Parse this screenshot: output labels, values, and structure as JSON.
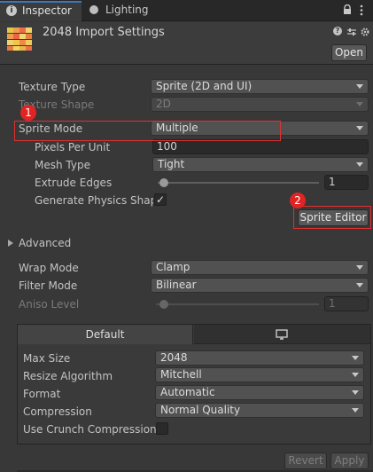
{
  "tabs": [
    {
      "label": "Inspector",
      "icon": "info-icon"
    },
    {
      "label": "Lighting",
      "icon": "lightbulb-icon"
    }
  ],
  "header": {
    "title": "2048 Import Settings",
    "open_label": "Open"
  },
  "texture_type": {
    "label": "Texture Type",
    "value": "Sprite (2D and UI)"
  },
  "texture_shape": {
    "label": "Texture Shape",
    "value": "2D"
  },
  "sprite_mode": {
    "label": "Sprite Mode",
    "value": "Multiple"
  },
  "pixels_per_unit": {
    "label": "Pixels Per Unit",
    "value": "100"
  },
  "mesh_type": {
    "label": "Mesh Type",
    "value": "Tight"
  },
  "extrude_edges": {
    "label": "Extrude Edges",
    "value": "1"
  },
  "generate_physics": {
    "label": "Generate Physics Shape",
    "checked": true,
    "check_glyph": "✓"
  },
  "sprite_editor_label": "Sprite Editor",
  "markers": [
    "1",
    "2"
  ],
  "advanced_label": "Advanced",
  "wrap_mode": {
    "label": "Wrap Mode",
    "value": "Clamp"
  },
  "filter_mode": {
    "label": "Filter Mode",
    "value": "Bilinear"
  },
  "aniso_level": {
    "label": "Aniso Level",
    "value": "1"
  },
  "platform_tabs": {
    "default_label": "Default"
  },
  "max_size": {
    "label": "Max Size",
    "value": "2048"
  },
  "resize_algorithm": {
    "label": "Resize Algorithm",
    "value": "Mitchell"
  },
  "format": {
    "label": "Format",
    "value": "Automatic"
  },
  "compression": {
    "label": "Compression",
    "value": "Normal Quality"
  },
  "use_crunch": {
    "label": "Use Crunch Compression",
    "checked": false
  },
  "footer": {
    "revert_label": "Revert",
    "apply_label": "Apply"
  }
}
